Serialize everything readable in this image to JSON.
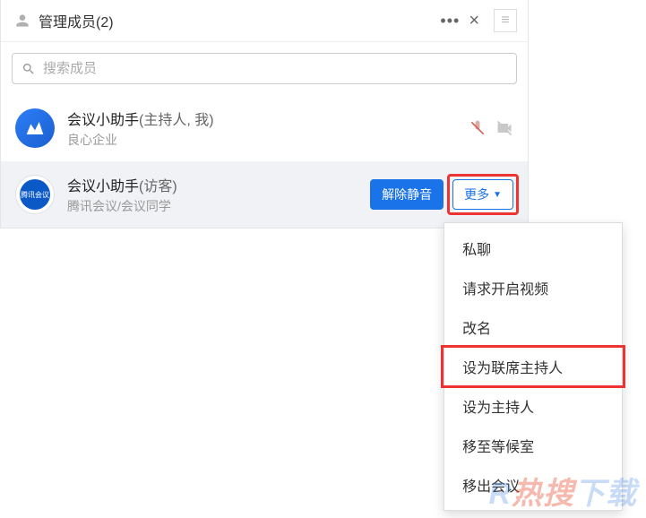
{
  "header": {
    "title": "管理成员(2)"
  },
  "search": {
    "placeholder": "搜索成员"
  },
  "members": [
    {
      "name": "会议小助手",
      "role": "(主持人, 我)",
      "sub": "良心企业"
    },
    {
      "name": "会议小助手",
      "role": "(访客)",
      "sub": "腾讯会议/会议同学"
    }
  ],
  "buttons": {
    "unmute": "解除静音",
    "more": "更多"
  },
  "dropdown": {
    "items": [
      "私聊",
      "请求开启视频",
      "改名",
      "设为联席主持人",
      "设为主持人",
      "移至等候室",
      "移出会议"
    ]
  },
  "watermark": {
    "main_left": "R",
    "main_mid": "热搜",
    "main_right": "下载",
    "sub": ""
  }
}
